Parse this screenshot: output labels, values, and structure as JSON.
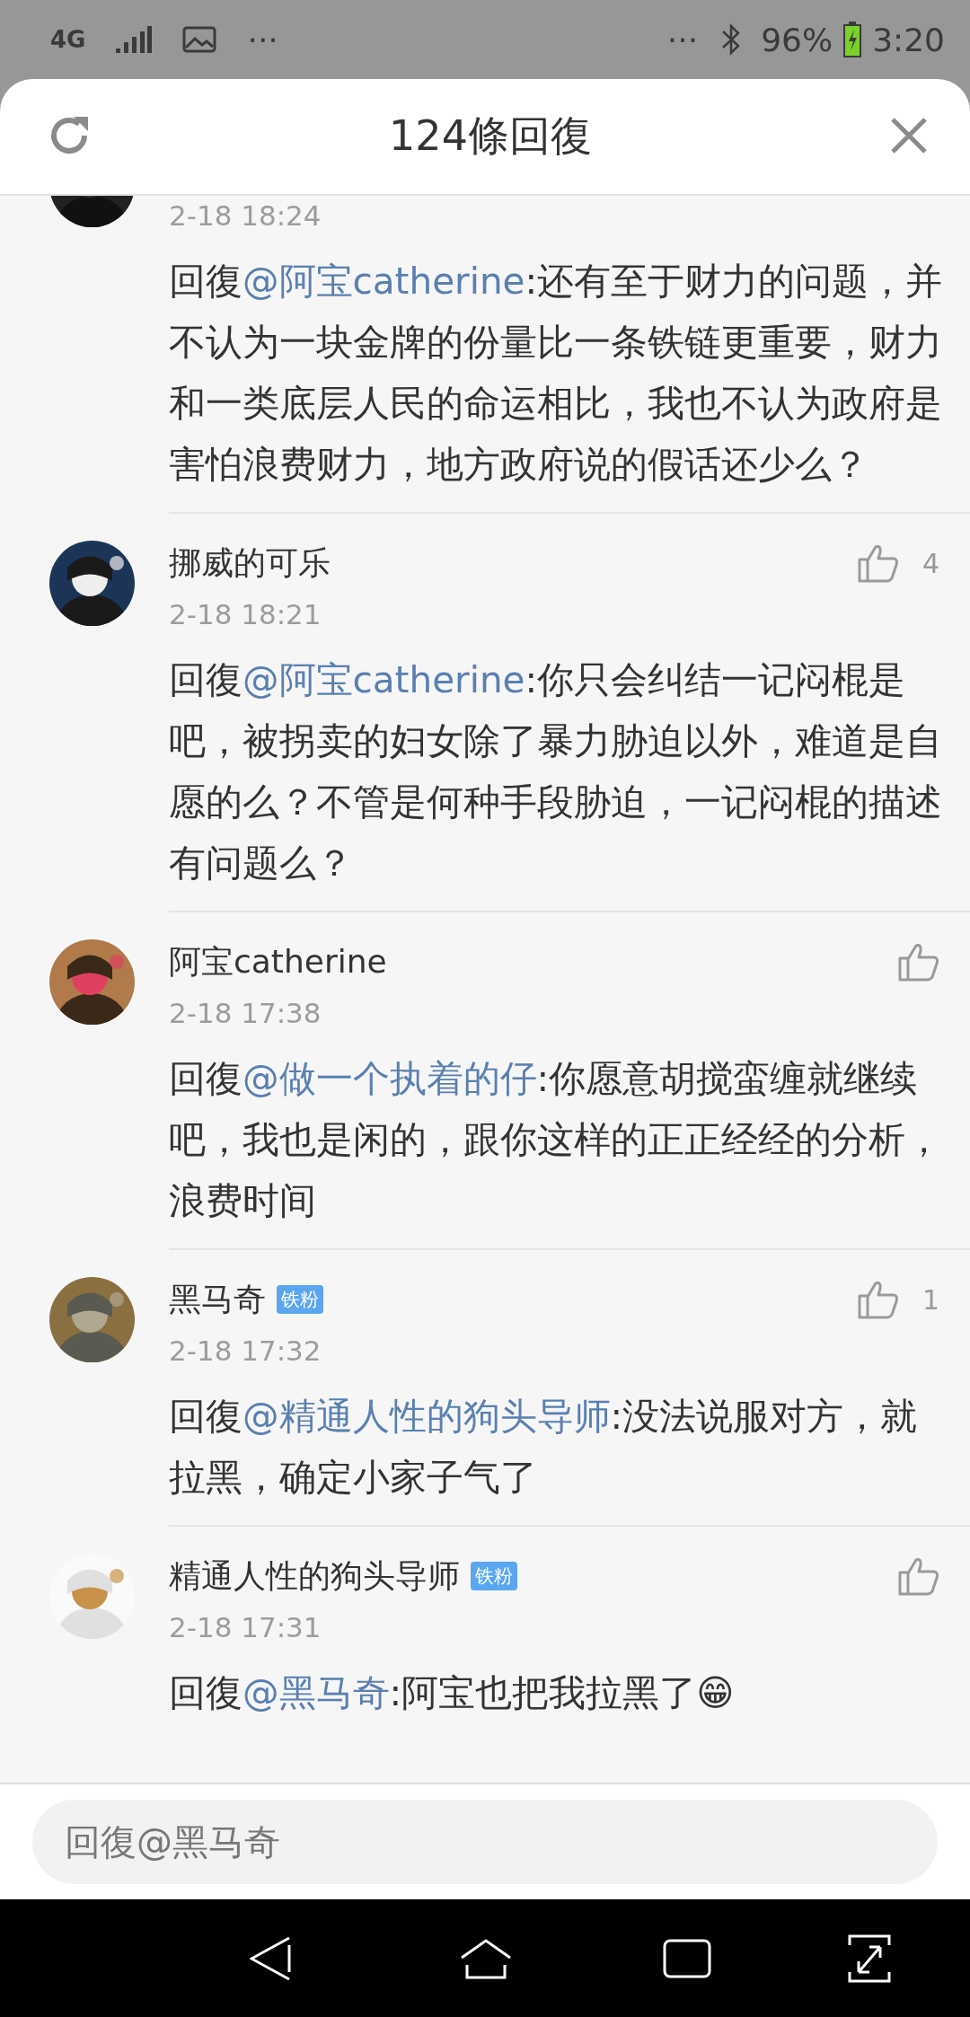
{
  "status_bar": {
    "network": "4G",
    "left_more": "···",
    "right_more": "···",
    "battery": "96%",
    "time": "3:20"
  },
  "header": {
    "title": "124條回復"
  },
  "comments": [
    {
      "date": "2-18 18:24",
      "prefix": "回復",
      "mention": "@阿宝catherine",
      "text": ":还有至于财力的问题，并不认为一块金牌的份量比一条铁链更重要，财力和一类底层人民的命运相比，我也不认为政府是害怕浪费财力，地方政府说的假话还少么？"
    },
    {
      "name": "挪威的可乐",
      "likes": "4",
      "date": "2-18 18:21",
      "prefix": "回復",
      "mention": "@阿宝catherine",
      "text": ":你只会纠结一记闷棍是吧，被拐卖的妇女除了暴力胁迫以外，难道是自愿的么？不管是何种手段胁迫，一记闷棍的描述有问题么？"
    },
    {
      "name": "阿宝catherine",
      "date": "2-18 17:38",
      "prefix": "回復",
      "mention": "@做一个执着的仔",
      "text": ":你愿意胡搅蛮缠就继续吧，我也是闲的，跟你这样的正正经经的分析，浪费时间"
    },
    {
      "name": "黑马奇",
      "badge": "铁粉",
      "likes": "1",
      "date": "2-18 17:32",
      "prefix": "回復",
      "mention": "@精通人性的狗头导师",
      "text": ":没法说服对方，就拉黑，确定小家子气了"
    },
    {
      "name": "精通人性的狗头导师",
      "badge": "铁粉",
      "date": "2-18 17:31",
      "prefix": "回復",
      "mention": "@黑马奇",
      "text": ":阿宝也把我拉黑了😁"
    }
  ],
  "reply_field": {
    "placeholder": "回復@黑马奇"
  }
}
